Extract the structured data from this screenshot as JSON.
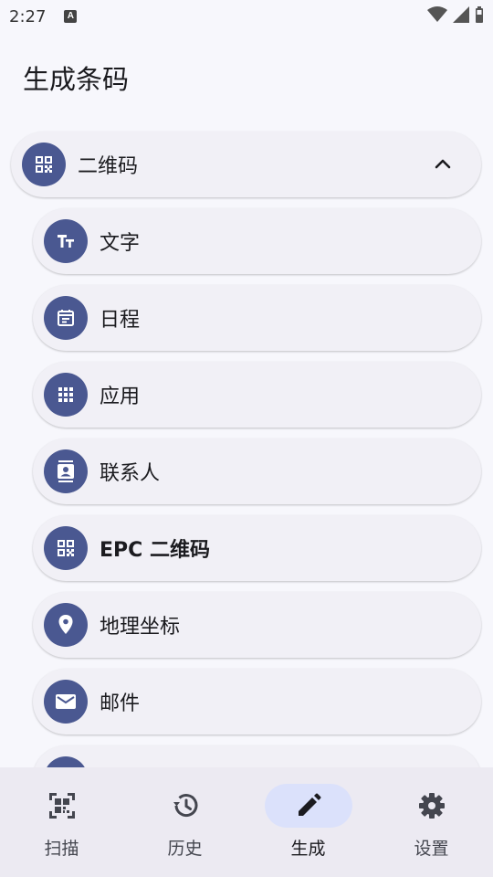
{
  "status_bar": {
    "time": "2:27",
    "notification_icon": "A"
  },
  "header": {
    "title": "生成条码"
  },
  "group": {
    "label": "二维码",
    "icon": "qr-code-icon",
    "expanded_icon": "chevron-up-icon"
  },
  "items": [
    {
      "label": "文字",
      "icon": "text-fields-icon"
    },
    {
      "label": "日程",
      "icon": "event-icon"
    },
    {
      "label": "应用",
      "icon": "apps-icon"
    },
    {
      "label": "联系人",
      "icon": "contact-icon"
    },
    {
      "label": "EPC 二维码",
      "icon": "qr-code-icon"
    },
    {
      "label": "地理坐标",
      "icon": "location-pin-icon"
    },
    {
      "label": "邮件",
      "icon": "mail-icon"
    }
  ],
  "bottom_nav": [
    {
      "label": "扫描",
      "icon": "qr-scan-icon",
      "active": false
    },
    {
      "label": "历史",
      "icon": "history-icon",
      "active": false
    },
    {
      "label": "生成",
      "icon": "pencil-icon",
      "active": true
    },
    {
      "label": "设置",
      "icon": "gear-icon",
      "active": false
    }
  ],
  "colors": {
    "accent": "#4a5891",
    "background": "#f7f7fc",
    "card": "#f1f0f6",
    "nav_active": "#dbe1fb"
  }
}
